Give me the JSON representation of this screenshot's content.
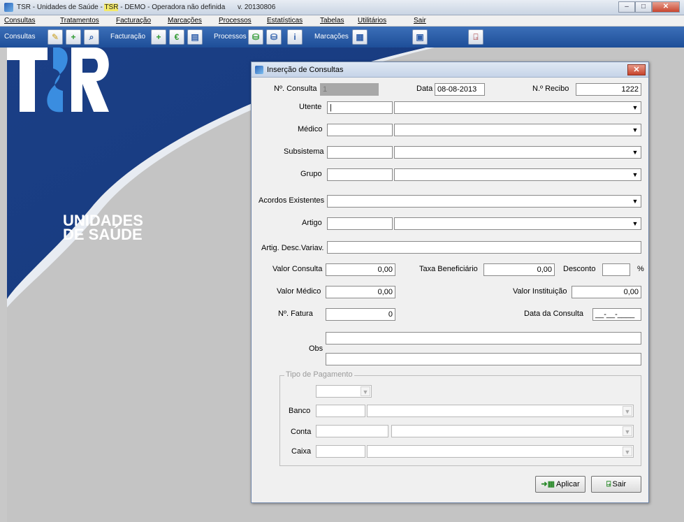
{
  "titlebar": {
    "title_prefix": "TSR - Unidades de Saúde - ",
    "title_highlight": "TSR",
    "title_suffix": " - DEMO - Operadora não definida",
    "version": "v. 20130806",
    "window_buttons": [
      "minimize",
      "maximize",
      "close"
    ]
  },
  "menu": {
    "items": [
      "Consultas",
      "Tratamentos",
      "Facturação",
      "Marcações",
      "Processos",
      "Estatísticas",
      "Tabelas",
      "Utilitários",
      "Sair"
    ]
  },
  "toolbar": {
    "consultas_label": "Consultas",
    "facturacao_label": "Facturação",
    "processos_label": "Processos",
    "marcacoes_label": "Marcações"
  },
  "logo": {
    "brand": "TSR",
    "line1": "UNIDADES",
    "line2": "DE SAÚDE"
  },
  "dialog": {
    "title": "Inserção de Consultas",
    "consulta_label": "Nº. Consulta",
    "consulta_value": "1",
    "data_label": "Data",
    "data_value": "08-08-2013",
    "recibo_label": "N.º Recibo",
    "recibo_value": "1222",
    "utente_label": "Utente",
    "medico_label": "Médico",
    "subsistema_label": "Subsistema",
    "grupo_label": "Grupo",
    "acordos_label": "Acordos Existentes",
    "artigo_label": "Artigo",
    "artigo_desc_label": "Artig. Desc.Variav.",
    "valor_consulta_label": "Valor Consulta",
    "valor_consulta_value": "0,00",
    "taxa_label": "Taxa Beneficiário",
    "taxa_value": "0,00",
    "desconto_label": "Desconto",
    "desconto_value": "",
    "percent": "%",
    "valor_medico_label": "Valor Médico",
    "valor_medico_value": "0,00",
    "valor_instituicao_label": "Valor Instituição",
    "valor_instituicao_value": "0,00",
    "fatura_label": "Nº. Fatura",
    "fatura_value": "0",
    "data_consulta_label": "Data da Consulta",
    "data_consulta_value": "__-__-____",
    "obs_label": "Obs",
    "pagamento": {
      "title": "Tipo de Pagamento",
      "banco_label": "Banco",
      "conta_label": "Conta",
      "caixa_label": "Caixa"
    },
    "aplicar_label": "Aplicar",
    "sair_label": "Sair"
  }
}
